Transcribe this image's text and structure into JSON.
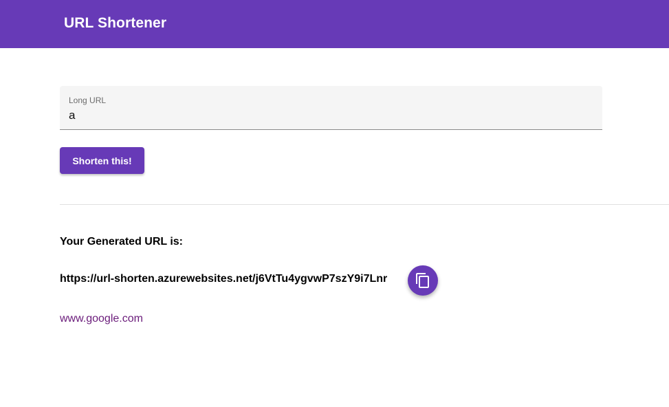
{
  "header": {
    "title": "URL Shortener"
  },
  "form": {
    "long_url_label": "Long URL",
    "long_url_value": "a",
    "submit_label": "Shorten this!"
  },
  "result": {
    "heading": "Your Generated URL is:",
    "short_url": "https://url-shorten.azurewebsites.net/j6VtTu4ygvwP7szY9i7Lnr",
    "copy_icon": "copy-icon",
    "original_url": "www.google.com"
  },
  "colors": {
    "primary": "#673ab7",
    "link": "#6a1b7a",
    "field_bg": "#f5f5f5"
  }
}
